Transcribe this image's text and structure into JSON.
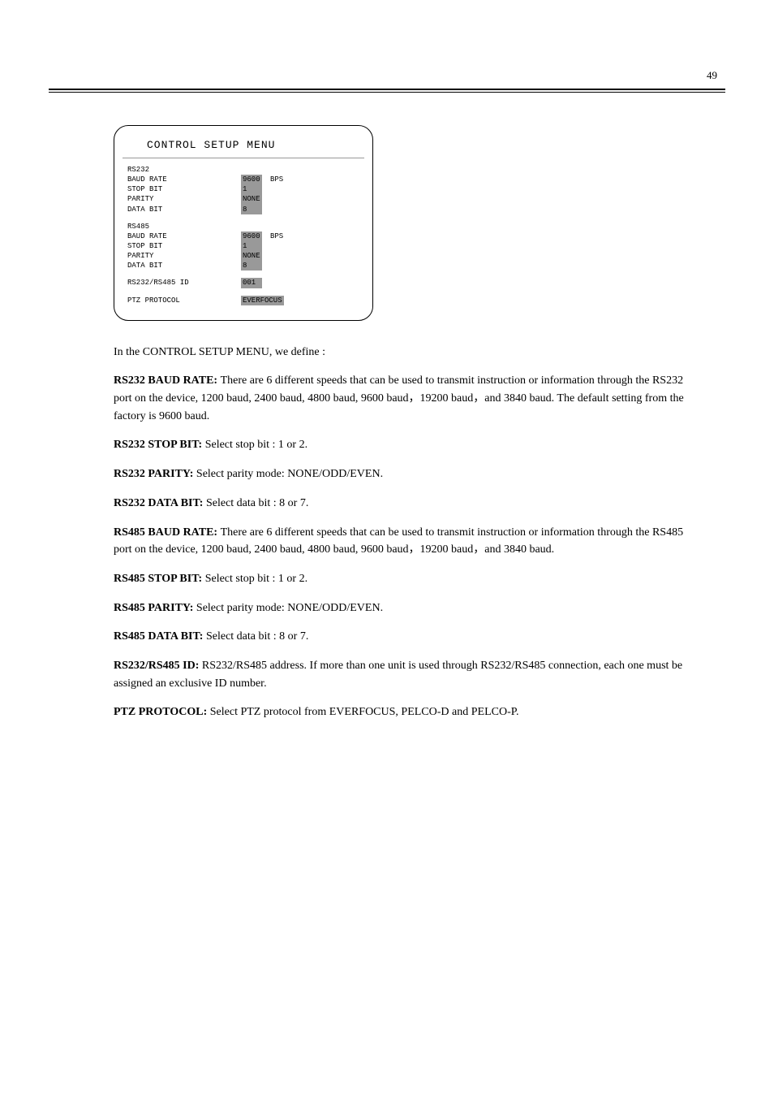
{
  "page_number": "49",
  "menu": {
    "title": "CONTROL SETUP MENU",
    "sections": {
      "rs232": {
        "header": "RS232",
        "baud_rate_label": "BAUD RATE",
        "baud_rate_value": "9600",
        "baud_rate_suffix": "BPS",
        "stop_bit_label": "STOP BIT",
        "stop_bit_value": "1",
        "parity_label": "PARITY",
        "parity_value": "NONE",
        "data_bit_label": "DATA BIT",
        "data_bit_value": "8"
      },
      "rs485": {
        "header": "RS485",
        "baud_rate_label": "BAUD RATE",
        "baud_rate_value": "9600",
        "baud_rate_suffix": "BPS",
        "stop_bit_label": "STOP BIT",
        "stop_bit_value": "1",
        "parity_label": "PARITY",
        "parity_value": "NONE",
        "data_bit_label": "DATA BIT",
        "data_bit_value": "8"
      },
      "id": {
        "label": "RS232/RS485 ID",
        "value": "001"
      },
      "ptz": {
        "label": "PTZ PROTOCOL",
        "value": "EVERFOCUS"
      }
    }
  },
  "description": {
    "intro": "In the CONTROL SETUP MENU, we define :",
    "items": {
      "rs232_baud_label": "RS232 BAUD RATE: ",
      "rs232_baud_text": "There are 6 different speeds that can be used to transmit instruction or information through the RS232 port on the device, 1200 baud, 2400 baud, 4800 baud, 9600 baud，19200 baud，and 3840 baud. The default setting from the factory is 9600 baud.",
      "rs232_stop_label": "RS232 STOP BIT: ",
      "rs232_stop_text": "Select stop bit : 1 or 2.",
      "rs232_parity_label": "RS232 PARITY: ",
      "rs232_parity_text": "Select parity mode: NONE/ODD/EVEN.",
      "rs232_data_label": "RS232 DATA BIT: ",
      "rs232_data_text": "Select data bit : 8 or 7.",
      "rs485_baud_label": "RS485 BAUD RATE: ",
      "rs485_baud_text": "There are 6 different speeds that can be used to transmit instruction or information through the RS485 port on the device, 1200 baud, 2400 baud, 4800 baud, 9600 baud，19200 baud，and 3840 baud.",
      "rs485_stop_label": "RS485 STOP BIT: ",
      "rs485_stop_text": "Select stop bit : 1 or 2.",
      "rs485_parity_label": "RS485 PARITY: ",
      "rs485_parity_text": "Select parity mode: NONE/ODD/EVEN.",
      "rs485_data_label": "RS485 DATA BIT: ",
      "rs485_data_text": "Select data bit : 8 or 7.",
      "id_label": "RS232/RS485 ID: ",
      "id_text": "RS232/RS485 address. If more than one unit is used through RS232/RS485 connection, each one must be assigned an exclusive ID number.",
      "ptz_label": "PTZ PROTOCOL: ",
      "ptz_text": "Select PTZ protocol from EVERFOCUS, PELCO-D and PELCO-P."
    }
  }
}
